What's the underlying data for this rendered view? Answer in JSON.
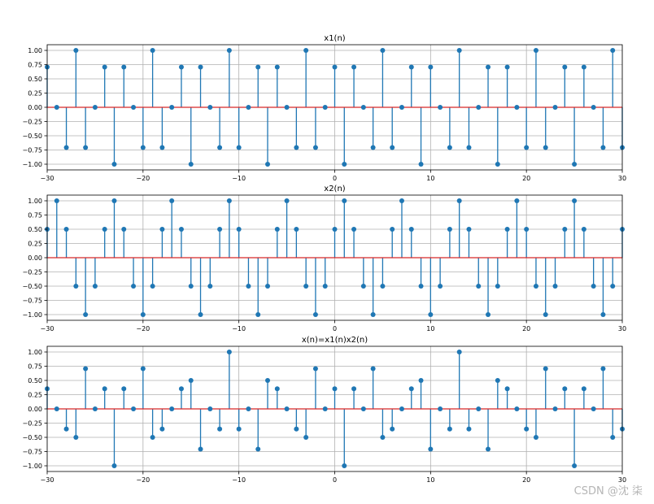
{
  "watermark": "CSDN @沈 柒",
  "style": {
    "stem_color": "#1f77b4",
    "baseline_color": "#d62728",
    "grid_color": "#b0b0b0"
  },
  "chart_data": [
    {
      "type": "stem",
      "title": "x1(n)",
      "xlim": [
        -30,
        30
      ],
      "ylim": [
        -1.1,
        1.1
      ],
      "xticks": [
        -30,
        -20,
        -10,
        0,
        10,
        20,
        30
      ],
      "yticks": [
        -1.0,
        -0.75,
        -0.5,
        -0.25,
        0.0,
        0.25,
        0.5,
        0.75,
        1.0
      ],
      "ytick_labels": [
        "−1.00",
        "−0.75",
        "−0.50",
        "−0.25",
        "0.00",
        "0.25",
        "0.50",
        "0.75",
        "1.00"
      ],
      "xtick_labels": [
        "−30",
        "−20",
        "−10",
        "0",
        "10",
        "20",
        "30"
      ],
      "grid": true,
      "x": [
        -30,
        -29,
        -28,
        -27,
        -26,
        -25,
        -24,
        -23,
        -22,
        -21,
        -20,
        -19,
        -18,
        -17,
        -16,
        -15,
        -14,
        -13,
        -12,
        -11,
        -10,
        -9,
        -8,
        -7,
        -6,
        -5,
        -4,
        -3,
        -2,
        -1,
        0,
        1,
        2,
        3,
        4,
        5,
        6,
        7,
        8,
        9,
        10,
        11,
        12,
        13,
        14,
        15,
        16,
        17,
        18,
        19,
        20,
        21,
        22,
        23,
        24,
        25,
        26,
        27,
        28,
        29,
        30
      ],
      "values": [
        0.707,
        0,
        -0.707,
        1,
        -0.707,
        0,
        0.707,
        -1,
        0.707,
        0,
        -0.707,
        1,
        -0.707,
        0,
        0.707,
        -1,
        0.707,
        0,
        -0.707,
        1,
        -0.707,
        0,
        0.707,
        -1,
        0.707,
        0,
        -0.707,
        1,
        -0.707,
        0,
        0.707,
        -1,
        0.707,
        0,
        -0.707,
        1,
        -0.707,
        0,
        0.707,
        -1,
        0.707,
        0,
        -0.707,
        1,
        -0.707,
        0,
        0.707,
        -1,
        0.707,
        0,
        -0.707,
        1,
        -0.707,
        0,
        0.707,
        -1,
        0.707,
        0,
        -0.707,
        1,
        -0.707
      ]
    },
    {
      "type": "stem",
      "title": "x2(n)",
      "xlim": [
        -30,
        30
      ],
      "ylim": [
        -1.1,
        1.1
      ],
      "xticks": [
        -30,
        -20,
        -10,
        0,
        10,
        20,
        30
      ],
      "yticks": [
        -1.0,
        -0.75,
        -0.5,
        -0.25,
        0.0,
        0.25,
        0.5,
        0.75,
        1.0
      ],
      "ytick_labels": [
        "−1.00",
        "−0.75",
        "−0.50",
        "−0.25",
        "0.00",
        "0.25",
        "0.50",
        "0.75",
        "1.00"
      ],
      "xtick_labels": [
        "−30",
        "−20",
        "−10",
        "0",
        "10",
        "20",
        "30"
      ],
      "grid": true,
      "x": [
        -30,
        -29,
        -28,
        -27,
        -26,
        -25,
        -24,
        -23,
        -22,
        -21,
        -20,
        -19,
        -18,
        -17,
        -16,
        -15,
        -14,
        -13,
        -12,
        -11,
        -10,
        -9,
        -8,
        -7,
        -6,
        -5,
        -4,
        -3,
        -2,
        -1,
        0,
        1,
        2,
        3,
        4,
        5,
        6,
        7,
        8,
        9,
        10,
        11,
        12,
        13,
        14,
        15,
        16,
        17,
        18,
        19,
        20,
        21,
        22,
        23,
        24,
        25,
        26,
        27,
        28,
        29,
        30
      ],
      "values": [
        0.5,
        1,
        0.5,
        -0.5,
        -1,
        -0.5,
        0.5,
        1,
        0.5,
        -0.5,
        -1,
        -0.5,
        0.5,
        1,
        0.5,
        -0.5,
        -1,
        -0.5,
        0.5,
        1,
        0.5,
        -0.5,
        -1,
        -0.5,
        0.5,
        1,
        0.5,
        -0.5,
        -1,
        -0.5,
        0.5,
        1,
        0.5,
        -0.5,
        -1,
        -0.5,
        0.5,
        1,
        0.5,
        -0.5,
        -1,
        -0.5,
        0.5,
        1,
        0.5,
        -0.5,
        -1,
        -0.5,
        0.5,
        1,
        0.5,
        -0.5,
        -1,
        -0.5,
        0.5,
        1,
        0.5,
        -0.5,
        -1,
        -0.5,
        0.5
      ]
    },
    {
      "type": "stem",
      "title": "x(n)=x1(n)x2(n)",
      "xlim": [
        -30,
        30
      ],
      "ylim": [
        -1.1,
        1.1
      ],
      "xticks": [
        -30,
        -20,
        -10,
        0,
        10,
        20,
        30
      ],
      "yticks": [
        -1.0,
        -0.75,
        -0.5,
        -0.25,
        0.0,
        0.25,
        0.5,
        0.75,
        1.0
      ],
      "ytick_labels": [
        "−1.00",
        "−0.75",
        "−0.50",
        "−0.25",
        "0.00",
        "0.25",
        "0.50",
        "0.75",
        "1.00"
      ],
      "xtick_labels": [
        "−30",
        "−20",
        "−10",
        "0",
        "10",
        "20",
        "30"
      ],
      "grid": true,
      "x": [
        -30,
        -29,
        -28,
        -27,
        -26,
        -25,
        -24,
        -23,
        -22,
        -21,
        -20,
        -19,
        -18,
        -17,
        -16,
        -15,
        -14,
        -13,
        -12,
        -11,
        -10,
        -9,
        -8,
        -7,
        -6,
        -5,
        -4,
        -3,
        -2,
        -1,
        0,
        1,
        2,
        3,
        4,
        5,
        6,
        7,
        8,
        9,
        10,
        11,
        12,
        13,
        14,
        15,
        16,
        17,
        18,
        19,
        20,
        21,
        22,
        23,
        24,
        25,
        26,
        27,
        28,
        29,
        30
      ],
      "values": [
        0.354,
        0,
        -0.354,
        -0.5,
        0.707,
        0,
        0.354,
        -1,
        0.354,
        0,
        0.707,
        -0.5,
        -0.354,
        0,
        0.354,
        0.5,
        -0.707,
        0,
        -0.354,
        1,
        -0.354,
        0,
        -0.707,
        0.5,
        0.354,
        0,
        -0.354,
        -0.5,
        0.707,
        0,
        0.354,
        -1,
        0.354,
        0,
        0.707,
        -0.5,
        -0.354,
        0,
        0.354,
        0.5,
        -0.707,
        0,
        -0.354,
        1,
        -0.354,
        0,
        -0.707,
        0.5,
        0.354,
        0,
        -0.354,
        -0.5,
        0.707,
        0,
        0.354,
        -1,
        0.354,
        0,
        0.707,
        -0.5,
        -0.354
      ]
    }
  ]
}
